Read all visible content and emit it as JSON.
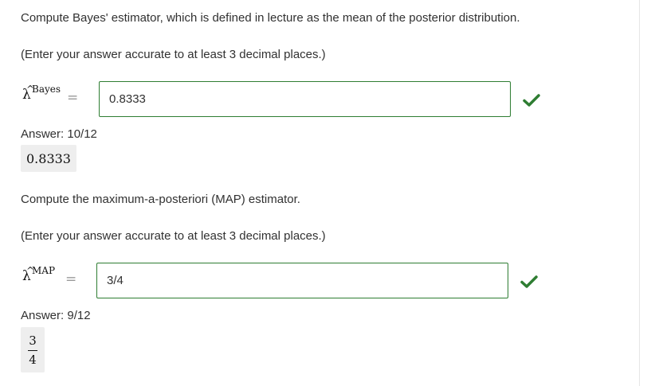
{
  "colors": {
    "correct_border": "#2e7d32",
    "check_green": "#2e7d32",
    "answer_bg": "#eeeeee"
  },
  "q1": {
    "prompt": "Compute Bayes' estimator, which is defined in lecture as the mean of the posterior distribution.",
    "note": "(Enter your answer accurate to at least 3 decimal places.)",
    "symbol": "λ",
    "hat": "^",
    "superscript": "Bayes",
    "equals": "=",
    "input_value": "0.8333",
    "status_icon": "check-icon",
    "answer_label": "Answer: 10/12",
    "answer_rendered": "0.8333"
  },
  "q2": {
    "prompt": "Compute the maximum-a-posteriori (MAP) estimator.",
    "note": "(Enter your answer accurate to at least 3 decimal places.)",
    "symbol": "λ",
    "hat": "^",
    "superscript": "MAP",
    "equals": "=",
    "input_value": "3/4",
    "status_icon": "check-icon",
    "answer_label": "Answer: 9/12",
    "answer_numerator": "3",
    "answer_denominator": "4"
  }
}
